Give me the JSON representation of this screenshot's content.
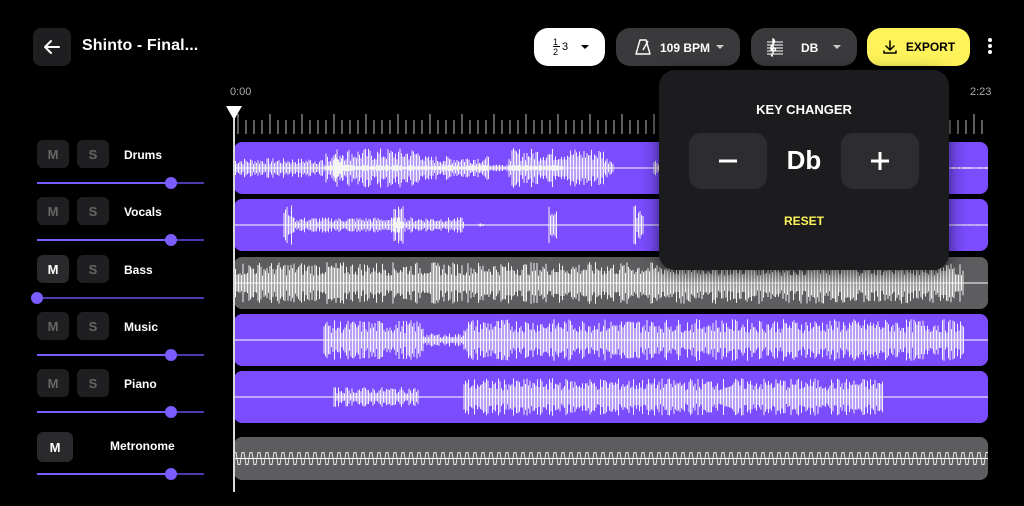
{
  "header": {
    "title": "Shinto - Final...",
    "time_signature": {
      "top": "1",
      "bottom": "2",
      "value": "3",
      "display": "1/2 3"
    },
    "bpm_label": "109 BPM",
    "key_label": "DB",
    "export_label": "EXPORT"
  },
  "timeline": {
    "start": "0:00",
    "end": "2:23",
    "playhead": 0.0
  },
  "tracks": [
    {
      "name": "Drums",
      "m": "M",
      "s": "S",
      "muted": false,
      "volume": 0.8,
      "color": "#7b4dff"
    },
    {
      "name": "Vocals",
      "m": "M",
      "s": "S",
      "muted": false,
      "volume": 0.8,
      "color": "#7b4dff"
    },
    {
      "name": "Bass",
      "m": "M",
      "s": "S",
      "muted": true,
      "volume": 0.0,
      "color": "#5d5d60"
    },
    {
      "name": "Music",
      "m": "M",
      "s": "S",
      "muted": false,
      "volume": 0.8,
      "color": "#7b4dff"
    },
    {
      "name": "Piano",
      "m": "M",
      "s": "S",
      "muted": false,
      "volume": 0.8,
      "color": "#7b4dff"
    },
    {
      "name": "Metronome",
      "m": "M",
      "muted": false,
      "volume": 0.8,
      "color": "#5d5d60"
    }
  ],
  "key_changer": {
    "title": "KEY CHANGER",
    "key": "Db",
    "minus": "−",
    "plus": "+",
    "reset": "RESET"
  },
  "colors": {
    "accent": "#7b4dff",
    "export": "#fef35a",
    "surface": "#1c1c1e",
    "muted_lane": "#5d5d60"
  }
}
